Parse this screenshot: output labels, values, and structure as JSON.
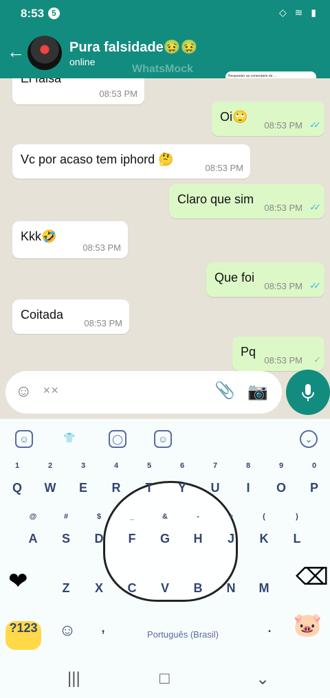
{
  "status": {
    "time": "8:53",
    "notification_count": "5",
    "system": "◇ ≋ ▮"
  },
  "header": {
    "title": "Pura falsidade🤢🤢",
    "subtitle": "online",
    "back_icon": "arrow-left-icon",
    "reply_note": "Responder ao comentário de ...",
    "watermark": "WhatsMock"
  },
  "messages": [
    {
      "dir": "in",
      "text": "Ei falsa",
      "time": "08:53 PM"
    },
    {
      "dir": "out",
      "text": "Oi🙄",
      "time": "08:53 PM",
      "status": "read"
    },
    {
      "dir": "in",
      "text": "Vc por acaso tem iphord 🤔",
      "time": "08:53 PM"
    },
    {
      "dir": "out",
      "text": "Claro que sim",
      "time": "08:53 PM",
      "status": "read"
    },
    {
      "dir": "in",
      "text": "Kkk🤣",
      "time": "08:53 PM"
    },
    {
      "dir": "out",
      "text": "Que foi",
      "time": "08:53 PM",
      "status": "read"
    },
    {
      "dir": "in",
      "text": "Coitada",
      "time": "08:53 PM"
    },
    {
      "dir": "out",
      "text": "Pq",
      "time": "08:53 PM",
      "status": "sent"
    }
  ],
  "composer": {
    "placeholder": "",
    "icons": [
      "emoji-icon",
      "gif-icon",
      "attachment-icon",
      "camera-icon",
      "microphone-icon"
    ]
  },
  "keyboard": {
    "row1": [
      "Q",
      "W",
      "E",
      "R",
      "T",
      "Y",
      "U",
      "I",
      "O",
      "P"
    ],
    "row1_nums": [
      "1",
      "2",
      "3",
      "4",
      "5",
      "6",
      "7",
      "8",
      "9",
      "0"
    ],
    "row2": [
      "A",
      "S",
      "D",
      "F",
      "G",
      "H",
      "J",
      "K",
      "L"
    ],
    "row2_symbols": [
      "@",
      "#",
      "$",
      "_",
      "&",
      "-",
      "+",
      "(",
      ")"
    ],
    "row3": [
      "Z",
      "X",
      "C",
      "V",
      "B",
      "N",
      "M"
    ],
    "space_label": "Português (Brasil)",
    "special_key": "?123",
    "comma": ",",
    "period": "."
  },
  "colors": {
    "accent": "#128c7e",
    "outgoing": "#dcf8c6",
    "incoming": "#ffffff",
    "chat_bg": "#e7e2d8",
    "keyboard_text": "#33446f"
  }
}
